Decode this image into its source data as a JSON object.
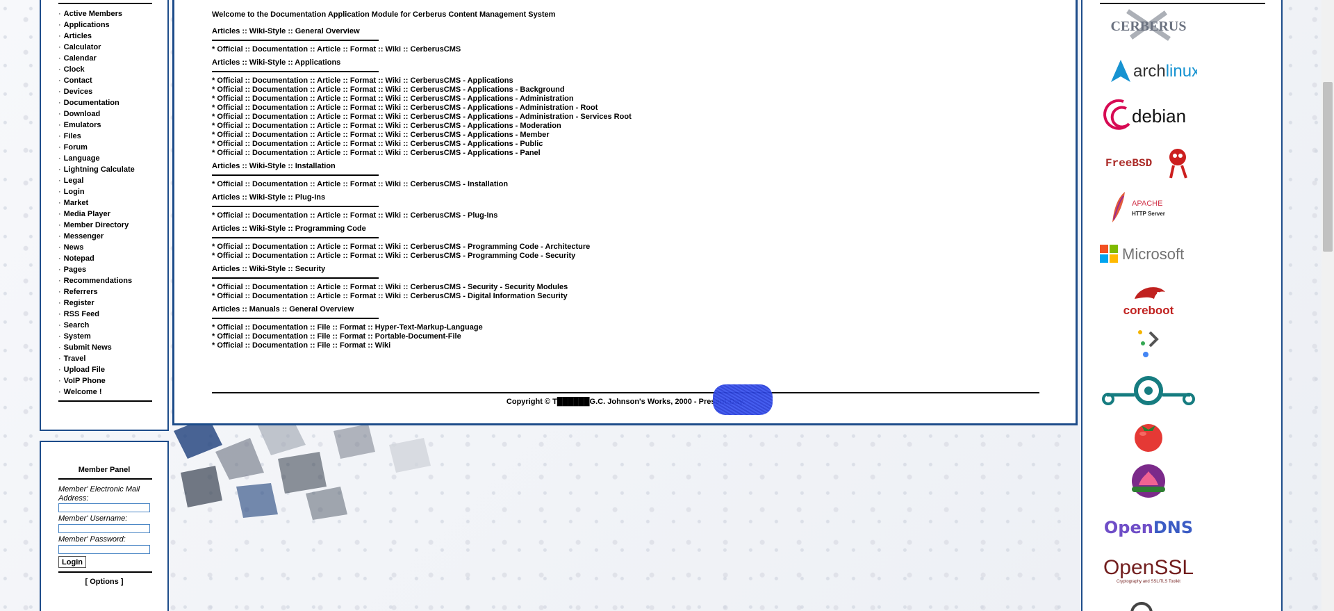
{
  "sidebar": {
    "items": [
      "Active Members",
      "Applications",
      "Articles",
      "Calculator",
      "Calendar",
      "Clock",
      "Contact",
      "Devices",
      "Documentation",
      "Download",
      "Emulators",
      "Files",
      "Forum",
      "Language",
      "Lightning Calculate",
      "Legal",
      "Login",
      "Market",
      "Media Player",
      "Member Directory",
      "Messenger",
      "News",
      "Notepad",
      "Pages",
      "Recommendations",
      "Referrers",
      "Register",
      "RSS Feed",
      "Search",
      "System",
      "Submit News",
      "Travel",
      "Upload File",
      "VoIP Phone",
      "Welcome !"
    ],
    "bullet": "·"
  },
  "member_panel": {
    "title": "Member Panel",
    "email_label": "Member' Electronic Mail Address:",
    "username_label": "Member' Username:",
    "password_label": "Member' Password:",
    "login_button": "Login",
    "options_link": "[ Options ]"
  },
  "main": {
    "welcome": "Welcome to the Documentation Application Module for Cerberus Content Management System",
    "sections": [
      {
        "heading": "Articles :: Wiki-Style :: General Overview",
        "links": [
          "* Official :: Documentation :: Article :: Format :: Wiki :: CerberusCMS"
        ]
      },
      {
        "heading": "Articles :: Wiki-Style :: Applications",
        "links": [
          "* Official :: Documentation :: Article :: Format :: Wiki :: CerberusCMS - Applications",
          "* Official :: Documentation :: Article :: Format :: Wiki :: CerberusCMS - Applications - Background",
          "* Official :: Documentation :: Article :: Format :: Wiki :: CerberusCMS - Applications - Administration",
          "* Official :: Documentation :: Article :: Format :: Wiki :: CerberusCMS - Applications - Administration - Root",
          "* Official :: Documentation :: Article :: Format :: Wiki :: CerberusCMS - Applications - Administration - Services Root",
          "* Official :: Documentation :: Article :: Format :: Wiki :: CerberusCMS - Applications - Moderation",
          "* Official :: Documentation :: Article :: Format :: Wiki :: CerberusCMS - Applications - Member",
          "* Official :: Documentation :: Article :: Format :: Wiki :: CerberusCMS - Applications - Public",
          "* Official :: Documentation :: Article :: Format :: Wiki :: CerberusCMS - Applications - Panel"
        ]
      },
      {
        "heading": "Articles :: Wiki-Style :: Installation",
        "links": [
          "* Official :: Documentation :: Article :: Format :: Wiki :: CerberusCMS - Installation"
        ]
      },
      {
        "heading": "Articles :: Wiki-Style :: Plug-Ins",
        "links": [
          "* Official :: Documentation :: Article :: Format :: Wiki :: CerberusCMS - Plug-Ins"
        ]
      },
      {
        "heading": "Articles :: Wiki-Style :: Programming Code",
        "links": [
          "* Official :: Documentation :: Article :: Format :: Wiki :: CerberusCMS - Programming Code - Architecture",
          "* Official :: Documentation :: Article :: Format :: Wiki :: CerberusCMS - Programming Code - Security"
        ]
      },
      {
        "heading": "Articles :: Wiki-Style :: Security",
        "links": [
          "* Official :: Documentation :: Article :: Format :: Wiki :: CerberusCMS - Security - Security Modules",
          "* Official :: Documentation :: Article :: Format :: Wiki :: CerberusCMS - Digital Information Security"
        ]
      },
      {
        "heading": "Articles :: Manuals :: General Overview",
        "links": [
          "* Official :: Documentation :: File :: Format :: Hyper-Text-Markup-Language",
          "* Official :: Documentation :: File :: Format :: Portable-Document-File",
          "* Official :: Documentation :: File :: Format :: Wiki"
        ]
      }
    ],
    "copyright": "Copyright © T██████G.C. Johnson's Works, 2000 - Present-Day."
  },
  "logos": {
    "cerberus": "CERBERUS",
    "archlinux": [
      "arch",
      "linux"
    ],
    "debian": "debian",
    "freebsd": "FreeBSD",
    "apache": [
      "APACHE",
      "HTTP Server"
    ],
    "microsoft": "Microsoft",
    "coreboot": "coreboot",
    "opendns": [
      "Open",
      "DNS"
    ],
    "openssl": [
      "OpenSSL",
      "Cryptography and SSL/TLS Toolkit"
    ]
  },
  "colors": {
    "frame": "#1d4c8a",
    "scribble": "#2a3fd6",
    "arch": "#1793d1",
    "debian": "#d70a53",
    "freebsd": "#ab2b28",
    "coreboot": "#c0211f",
    "lineageos": "#167c80",
    "opendns": "#6f4ec7",
    "openssl": "#721e1e"
  }
}
